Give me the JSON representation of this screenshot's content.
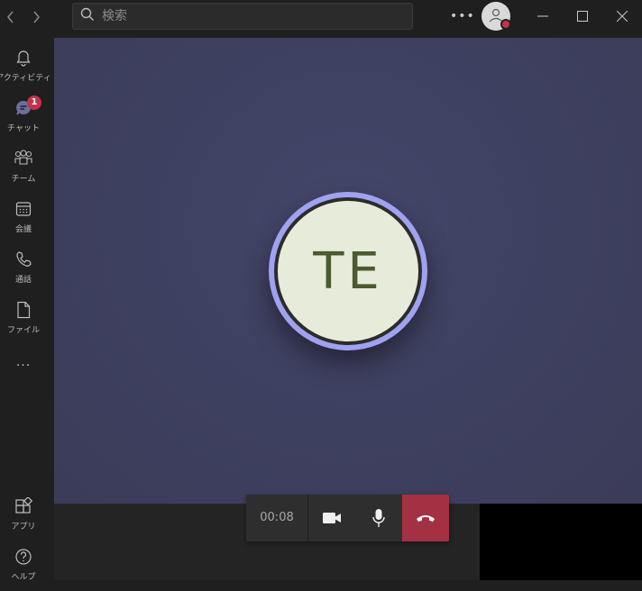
{
  "search": {
    "placeholder": "検索"
  },
  "rail": {
    "items": [
      {
        "label": "アクティビティ",
        "icon": "bell-icon"
      },
      {
        "label": "チャット",
        "icon": "chat-icon",
        "badge": "1"
      },
      {
        "label": "チーム",
        "icon": "teams-icon"
      },
      {
        "label": "会議",
        "icon": "calendar-icon"
      },
      {
        "label": "通話",
        "icon": "phone-icon"
      },
      {
        "label": "ファイル",
        "icon": "file-icon"
      }
    ],
    "more": "...",
    "bottom": [
      {
        "label": "アプリ",
        "icon": "apps-icon"
      },
      {
        "label": "ヘルプ",
        "icon": "help-icon"
      }
    ]
  },
  "call": {
    "initials": "TE",
    "timer": "00:08"
  },
  "colors": {
    "accent_ring": "#9fa2f0",
    "hangup": "#a33043",
    "badge": "#c4314b",
    "stage": "#3f4162"
  }
}
